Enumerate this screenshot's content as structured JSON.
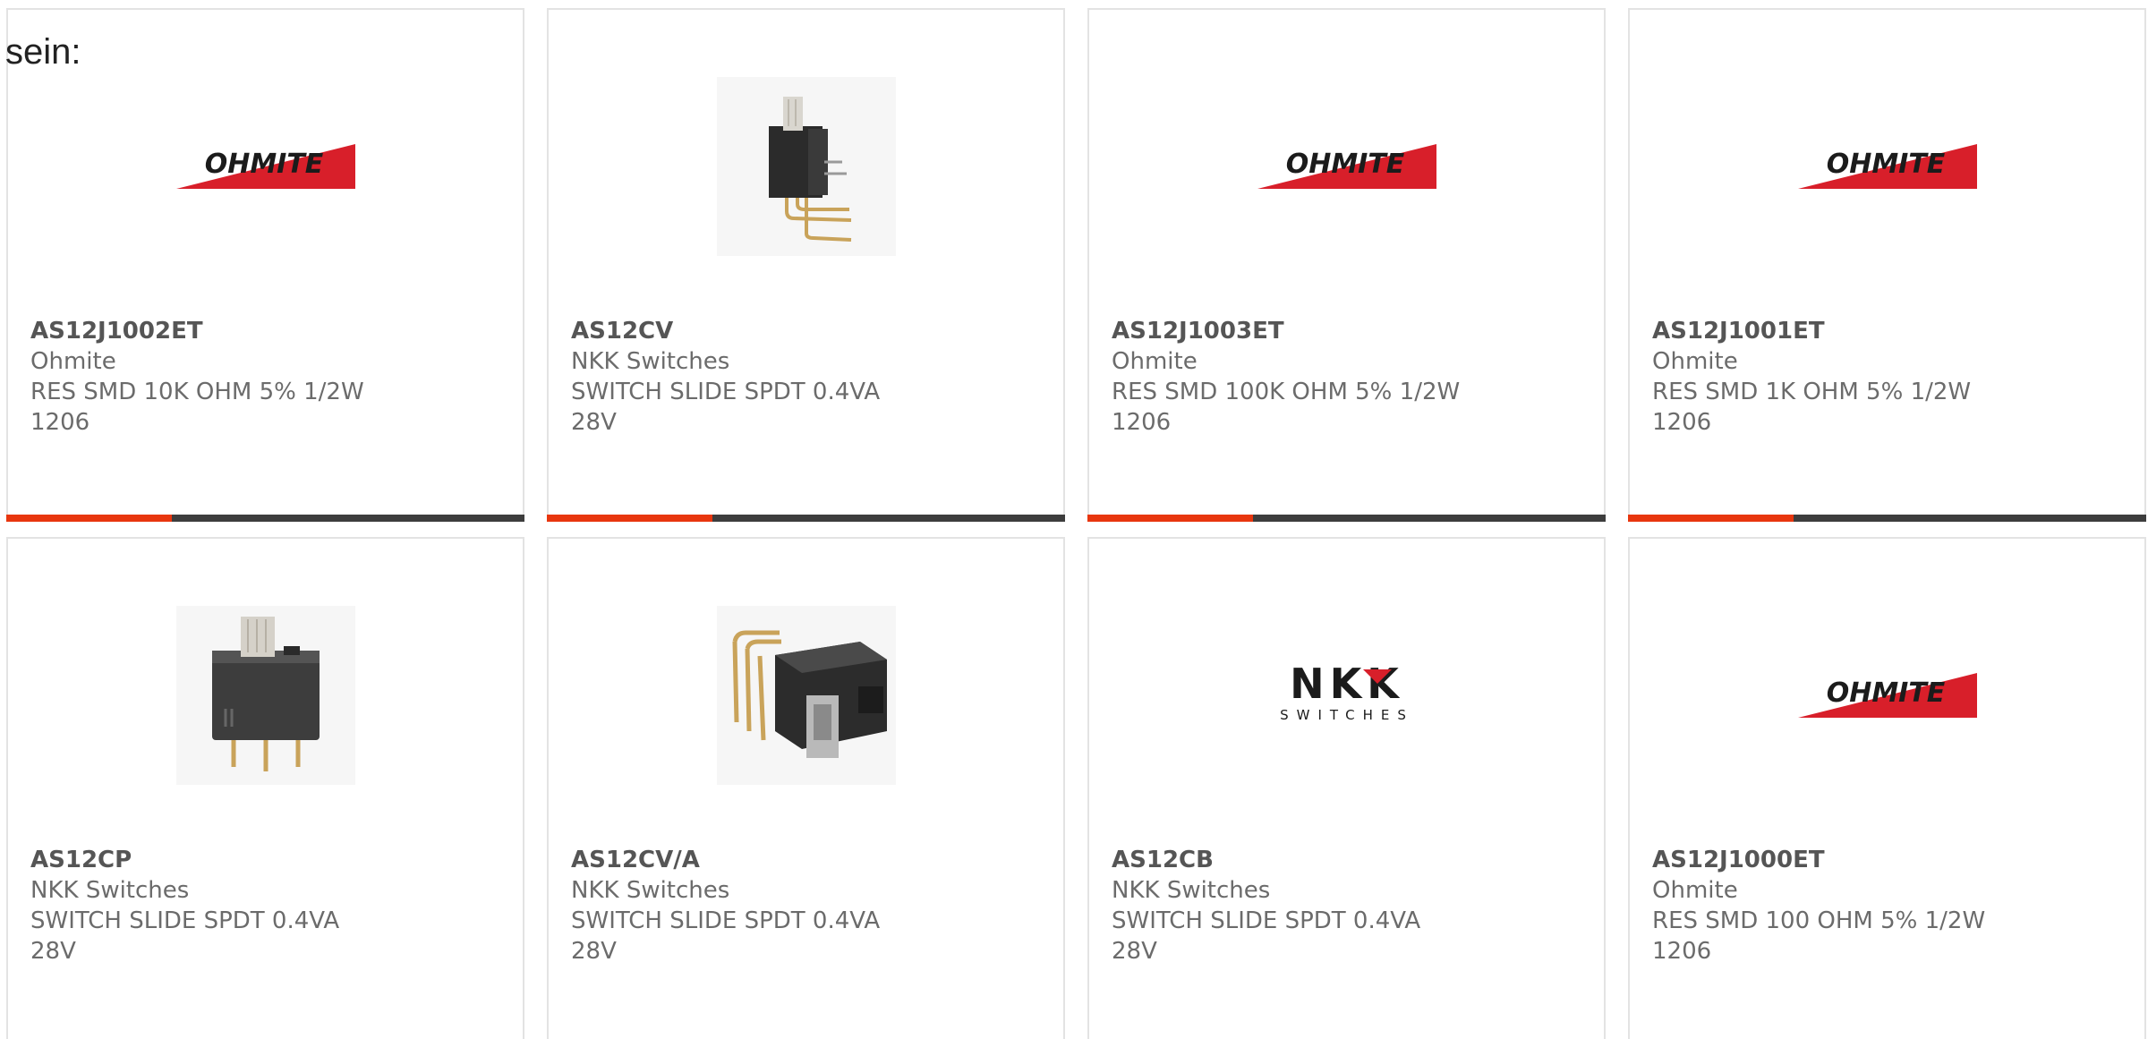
{
  "intro_text": "sein:",
  "accent_color": "#e8360e",
  "track_color": "#3d3d3d",
  "products": [
    {
      "part_number": "AS12J1002ET",
      "manufacturer": "Ohmite",
      "description": "RES SMD 10K OHM 5% 1/2W 1206",
      "image": "ohmite-logo",
      "progress_fraction": 0.32
    },
    {
      "part_number": "AS12CV",
      "manufacturer": "NKK Switches",
      "description": "SWITCH SLIDE SPDT 0.4VA 28V",
      "image": "slide-switch-vertical-photo",
      "progress_fraction": 0.32
    },
    {
      "part_number": "AS12J1003ET",
      "manufacturer": "Ohmite",
      "description": "RES SMD 100K OHM 5% 1/2W 1206",
      "image": "ohmite-logo",
      "progress_fraction": 0.32
    },
    {
      "part_number": "AS12J1001ET",
      "manufacturer": "Ohmite",
      "description": "RES SMD 1K OHM 5% 1/2W 1206",
      "image": "ohmite-logo",
      "progress_fraction": 0.32
    },
    {
      "part_number": "AS12CP",
      "manufacturer": "NKK Switches",
      "description": "SWITCH SLIDE SPDT 0.4VA 28V",
      "image": "slide-switch-pcb-photo",
      "progress_fraction": null
    },
    {
      "part_number": "AS12CV/A",
      "manufacturer": "NKK Switches",
      "description": "SWITCH SLIDE SPDT 0.4VA 28V",
      "image": "slide-switch-right-angle-photo",
      "progress_fraction": null
    },
    {
      "part_number": "AS12CB",
      "manufacturer": "NKK Switches",
      "description": "SWITCH SLIDE SPDT 0.4VA 28V",
      "image": "nkk-switches-logo",
      "progress_fraction": null
    },
    {
      "part_number": "AS12J1000ET",
      "manufacturer": "Ohmite",
      "description": "RES SMD 100 OHM 5% 1/2W 1206",
      "image": "ohmite-logo",
      "progress_fraction": null
    }
  ],
  "logos": {
    "ohmite": "OHMITE",
    "nkk_main": "NKK",
    "nkk_sub": "SWITCHES"
  }
}
